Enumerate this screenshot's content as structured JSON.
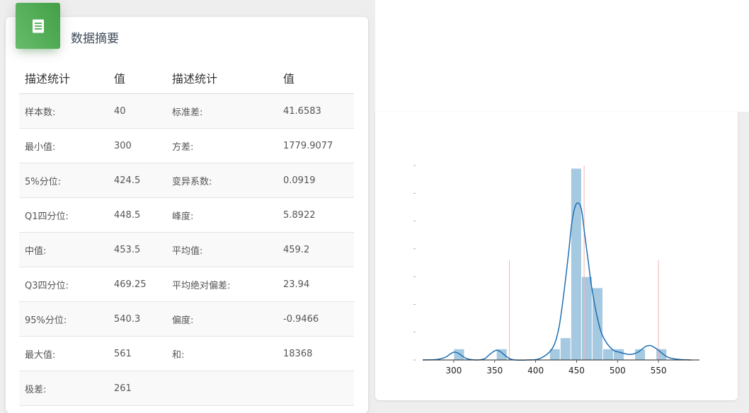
{
  "summary": {
    "title": "数据摘要",
    "icon": "document-list-icon",
    "accent_color": "#4caf50",
    "headers": [
      "描述统计",
      "值",
      "描述统计",
      "值"
    ],
    "rows": [
      [
        "样本数:",
        "40",
        "标准差:",
        "41.6583"
      ],
      [
        "最小值:",
        "300",
        "方差:",
        "1779.9077"
      ],
      [
        "5%分位:",
        "424.5",
        "变异系数:",
        "0.0919"
      ],
      [
        "Q1四分位:",
        "448.5",
        "峰度:",
        "5.8922"
      ],
      [
        "中值:",
        "453.5",
        "平均值:",
        "459.2"
      ],
      [
        "Q3四分位:",
        "469.25",
        "平均绝对偏差:",
        "23.94"
      ],
      [
        "95%分位:",
        "540.3",
        "偏度:",
        "-0.9466"
      ],
      [
        "最大值:",
        "561",
        "和:",
        "18368"
      ],
      [
        "极差:",
        "261",
        "",
        ""
      ]
    ]
  },
  "chart_data": {
    "type": "bar",
    "xticks": [
      300,
      350,
      400,
      450,
      500,
      550
    ],
    "xlim": [
      262,
      600
    ],
    "ylim": [
      0,
      7
    ],
    "histogram": {
      "bin_width": 13,
      "bins": [
        {
          "x0": 300,
          "count": 0.4
        },
        {
          "x0": 352,
          "count": 0.4
        },
        {
          "x0": 417,
          "count": 0.4
        },
        {
          "x0": 430,
          "count": 0.8
        },
        {
          "x0": 443,
          "count": 6.9
        },
        {
          "x0": 456,
          "count": 3.0
        },
        {
          "x0": 469,
          "count": 2.6
        },
        {
          "x0": 482,
          "count": 0.4
        },
        {
          "x0": 495,
          "count": 0.4
        },
        {
          "x0": 521,
          "count": 0.4
        },
        {
          "x0": 547,
          "count": 0.4
        }
      ],
      "bar_color": "#8fbbda"
    },
    "kde": {
      "x": [
        262,
        280,
        290,
        295,
        300,
        305,
        310,
        315,
        320,
        330,
        338,
        342,
        347,
        352,
        357,
        361,
        368,
        375,
        390,
        405,
        420,
        428,
        434,
        440,
        444,
        448,
        452,
        456,
        460,
        464,
        468,
        474,
        480,
        487,
        495,
        502,
        510,
        515,
        520,
        526,
        534,
        540,
        545,
        550,
        556,
        563,
        575,
        590
      ],
      "y": [
        0.0,
        0.02,
        0.1,
        0.2,
        0.28,
        0.25,
        0.15,
        0.06,
        0.02,
        0.0,
        0.05,
        0.15,
        0.27,
        0.35,
        0.3,
        0.2,
        0.05,
        0.0,
        0.0,
        0.05,
        0.4,
        1.1,
        2.3,
        3.8,
        4.9,
        5.5,
        5.65,
        5.4,
        4.5,
        3.6,
        2.7,
        1.7,
        1.0,
        0.6,
        0.35,
        0.28,
        0.22,
        0.2,
        0.22,
        0.3,
        0.48,
        0.52,
        0.45,
        0.35,
        0.2,
        0.08,
        0.02,
        0.0
      ],
      "color": "#1f6fb2"
    },
    "vlines": [
      {
        "x": 368,
        "color": "#f4b3b3",
        "height": 3.6
      },
      {
        "x": 459.2,
        "color": "#f4b3b3",
        "height": 7.0
      },
      {
        "x": 550,
        "color": "#f4b3b3",
        "height": 3.6
      }
    ]
  }
}
